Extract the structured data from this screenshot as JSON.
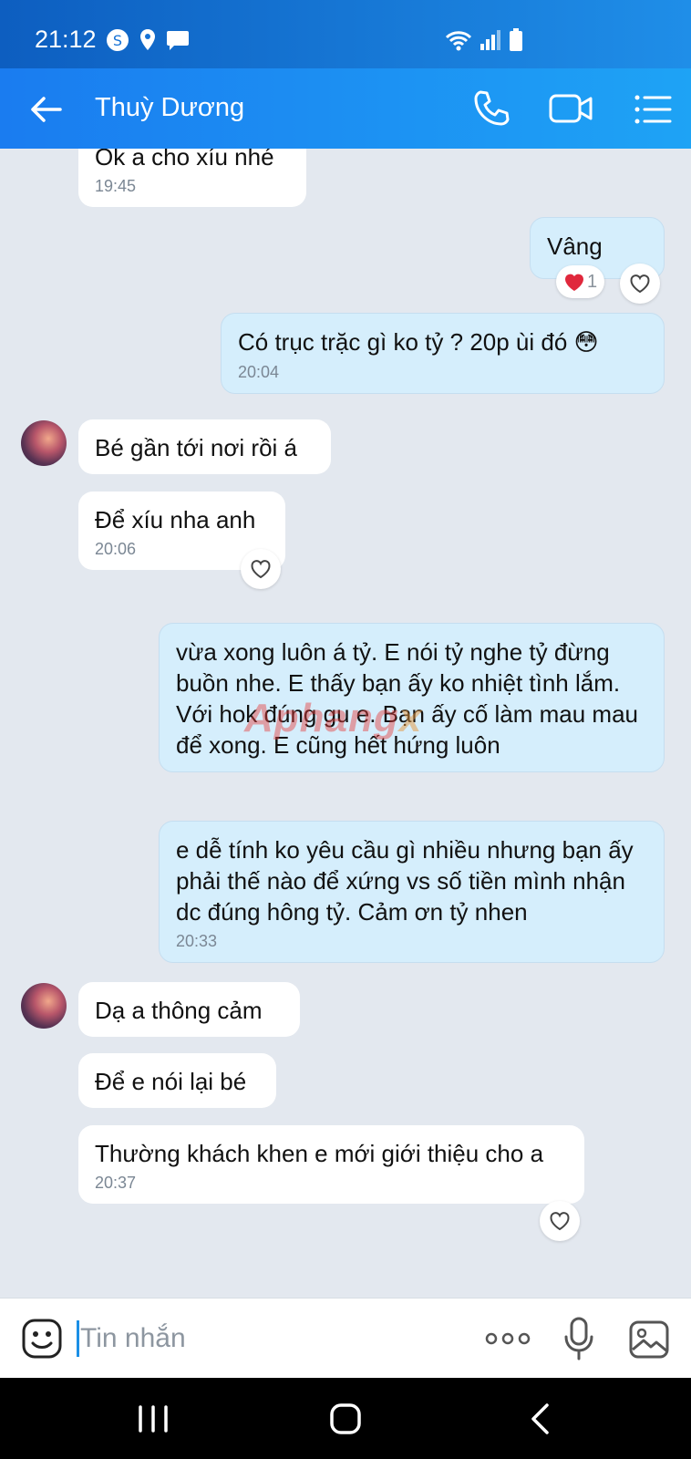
{
  "status_bar": {
    "time": "21:12"
  },
  "header": {
    "contact_name": "Thuỳ Dương"
  },
  "messages": [
    {
      "id": "m1",
      "text": "Ok a cho xíu nhé",
      "time": "19:45"
    },
    {
      "id": "m2",
      "text": "Vâng",
      "reaction_count": "1"
    },
    {
      "id": "m3",
      "text": "Có trục trặc gì ko tỷ ? 20p ùi đó",
      "emoji": "😳",
      "time": "20:04"
    },
    {
      "id": "m4",
      "text": "Bé gần tới nơi rồi á"
    },
    {
      "id": "m5",
      "text": "Để xíu nha anh",
      "time": "20:06"
    },
    {
      "id": "m6",
      "text": "vừa xong luôn á tỷ. E nói tỷ nghe tỷ đừng buồn nhe. E thấy bạn ấy ko nhiệt tình lắm. Với hok đúng gu e. Bạn ấy cố làm mau mau để xong. E cũng hết hứng luôn"
    },
    {
      "id": "m7",
      "text": "e dễ tính ko yêu cầu gì nhiều nhưng bạn ấy phải thế nào để xứng vs số tiền mình nhận dc đúng hông tỷ. Cảm ơn tỷ nhen",
      "time": "20:33"
    },
    {
      "id": "m8",
      "text": "Dạ a thông cảm"
    },
    {
      "id": "m9",
      "text": "Để e nói lại bé"
    },
    {
      "id": "m10",
      "text": "Thường khách khen e mới giới thiệu cho a",
      "time": "20:37"
    }
  ],
  "watermark": {
    "part1": "Aphang",
    "part2": "x"
  },
  "input": {
    "placeholder": "Tin nhắn"
  },
  "colors": {
    "header_start": "#1a7cf0",
    "header_end": "#1ea3f5",
    "outgoing_bubble": "#d5eefc",
    "incoming_bubble": "#ffffff",
    "chat_background": "#e3e8ef"
  }
}
